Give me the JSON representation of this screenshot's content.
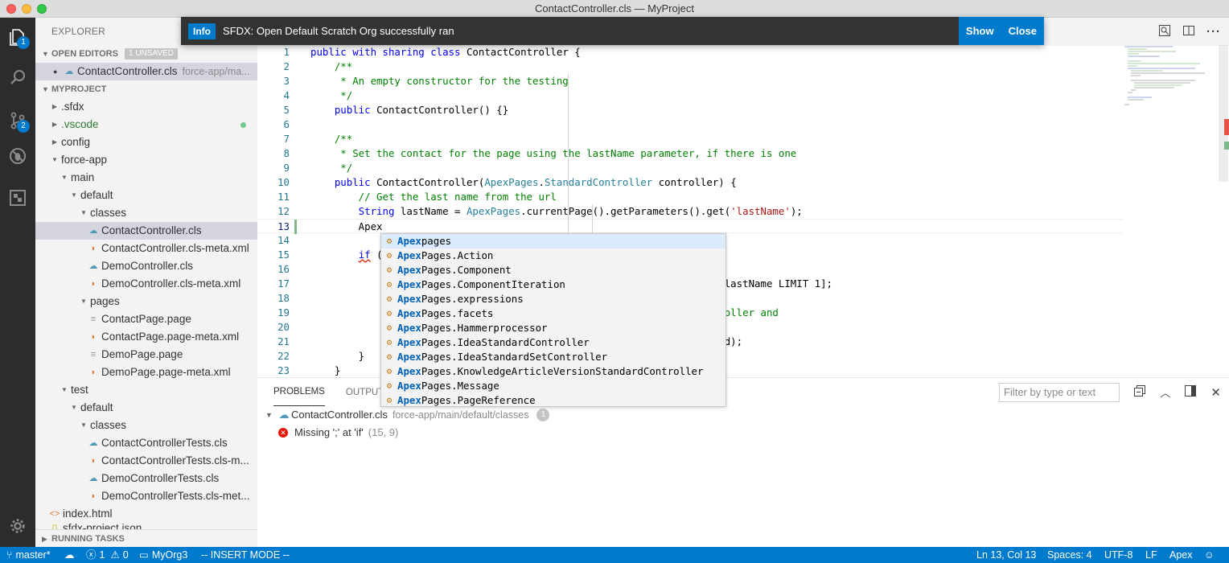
{
  "window": {
    "title": "ContactController.cls — MyProject"
  },
  "activity": {
    "explorer_badge": "1",
    "scm_badge": "2"
  },
  "notification": {
    "badge": "Info",
    "message": "SFDX: Open Default Scratch Org successfully ran",
    "show": "Show",
    "close": "Close"
  },
  "sidebar": {
    "title": "EXPLORER",
    "open_editors": {
      "label": "OPEN EDITORS",
      "badge": "1 UNSAVED",
      "file": "ContactController.cls",
      "path": "force-app/ma..."
    },
    "project_label": "MYPROJECT",
    "tree": [
      ".sfdx",
      ".vscode",
      "config",
      "force-app",
      "main",
      "default",
      "classes",
      "ContactController.cls",
      "ContactController.cls-meta.xml",
      "DemoController.cls",
      "DemoController.cls-meta.xml",
      "pages",
      "ContactPage.page",
      "ContactPage.page-meta.xml",
      "DemoPage.page",
      "DemoPage.page-meta.xml",
      "test",
      "default",
      "classes",
      "ContactControllerTests.cls",
      "ContactControllerTests.cls-m...",
      "DemoControllerTests.cls",
      "DemoControllerTests.cls-met...",
      "index.html",
      "sfdx-project.json"
    ],
    "running_tasks": "RUNNING TASKS"
  },
  "editor": {
    "lines": [
      [
        {
          "t": "public with sharing class ",
          "c": "kw"
        },
        {
          "t": "ContactController {",
          "c": ""
        }
      ],
      [
        {
          "t": "    /**",
          "c": "cm"
        }
      ],
      [
        {
          "t": "     * An empty constructor for the testing",
          "c": "cm"
        }
      ],
      [
        {
          "t": "     */",
          "c": "cm"
        }
      ],
      [
        {
          "t": "    public ",
          "c": "kw"
        },
        {
          "t": "ContactController() {}",
          "c": ""
        }
      ],
      [
        {
          "t": "",
          "c": ""
        }
      ],
      [
        {
          "t": "    /**",
          "c": "cm"
        }
      ],
      [
        {
          "t": "     * Set the contact for the page using the lastName parameter, if there is one",
          "c": "cm"
        }
      ],
      [
        {
          "t": "     */",
          "c": "cm"
        }
      ],
      [
        {
          "t": "    public ",
          "c": "kw"
        },
        {
          "t": "ContactController(",
          "c": ""
        },
        {
          "t": "ApexPages",
          "c": "ty"
        },
        {
          "t": ".",
          "c": ""
        },
        {
          "t": "StandardController",
          "c": "ty"
        },
        {
          "t": " controller) {",
          "c": ""
        }
      ],
      [
        {
          "t": "        // Get the last name from the url",
          "c": "cm"
        }
      ],
      [
        {
          "t": "        String ",
          "c": "kw"
        },
        {
          "t": "lastName = ",
          "c": ""
        },
        {
          "t": "ApexPages",
          "c": "ty"
        },
        {
          "t": ".currentPage().getParameters().get(",
          "c": ""
        },
        {
          "t": "'lastName'",
          "c": "st"
        },
        {
          "t": ");",
          "c": ""
        }
      ],
      [
        {
          "t": "        Apex",
          "c": ""
        }
      ],
      [
        {
          "t": "",
          "c": ""
        }
      ],
      [
        {
          "t": "        ",
          "c": ""
        },
        {
          "t": "if",
          "c": "kw"
        },
        {
          "t": " (",
          "c": ""
        }
      ],
      [
        {
          "t": "",
          "c": ""
        }
      ],
      [
        {
          "t": "                                                                  = :lastName LIMIT 1];",
          "c": ""
        }
      ],
      [
        {
          "t": "",
          "c": ""
        }
      ],
      [
        {
          "t": "                                                                  ntroller and",
          "c": "cm"
        }
      ],
      [
        {
          "t": "",
          "c": ""
        }
      ],
      [
        {
          "t": "                                                                  t.Id);",
          "c": ""
        }
      ],
      [
        {
          "t": "        }",
          "c": ""
        }
      ],
      [
        {
          "t": "    }",
          "c": ""
        }
      ]
    ]
  },
  "suggest": {
    "typed": "Apex",
    "items": [
      "pages",
      "Pages.Action",
      "Pages.Component",
      "Pages.ComponentIteration",
      "Pages.expressions",
      "Pages.facets",
      "Pages.Hammerprocessor",
      "Pages.IdeaStandardController",
      "Pages.IdeaStandardSetController",
      "Pages.KnowledgeArticleVersionStandardController",
      "Pages.Message",
      "Pages.PageReference"
    ]
  },
  "panel": {
    "tabs": [
      "PROBLEMS",
      "OUTPUT"
    ],
    "filter_placeholder": "Filter by type or text",
    "file": "ContactController.cls",
    "path": "force-app/main/default/classes",
    "count": "1",
    "error_message": "Missing ';' at 'if'",
    "error_pos": "(15, 9)"
  },
  "status": {
    "branch": "master*",
    "errors": "1",
    "warnings": "0",
    "org": "MyOrg3",
    "mode": "-- INSERT MODE --",
    "position": "Ln 13, Col 13",
    "spaces": "Spaces: 4",
    "encoding": "UTF-8",
    "eol": "LF",
    "language": "Apex"
  },
  "colors": {
    "accent": "#007acc",
    "activity_bar": "#2c2c2c",
    "sidebar": "#f3f3f3"
  }
}
